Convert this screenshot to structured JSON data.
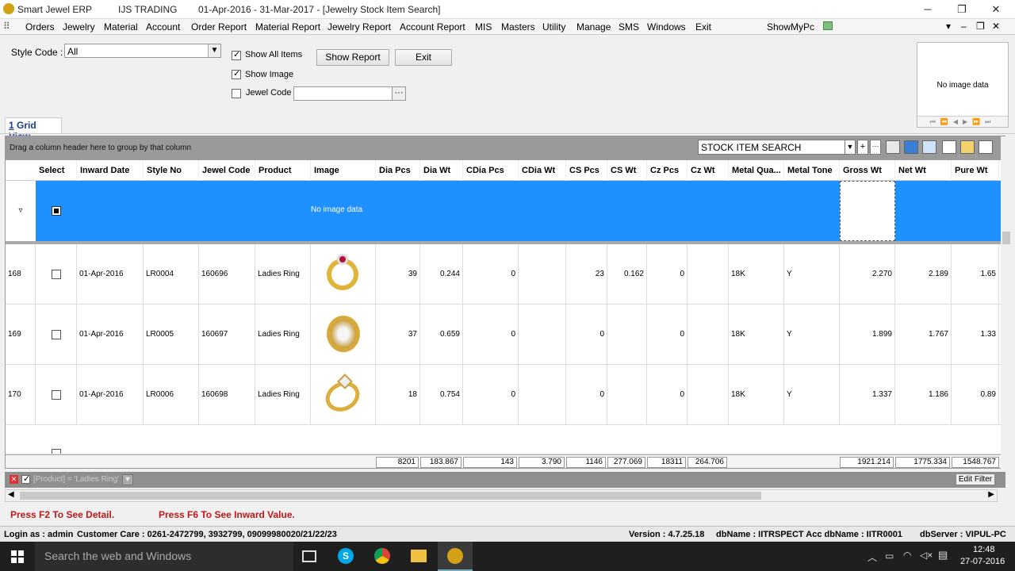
{
  "window": {
    "app_name": "Smart Jewel ERP",
    "company": "IJS TRADING",
    "title": "01-Apr-2016 - 31-Mar-2017 - [Jewelry Stock Item Search]"
  },
  "menu": [
    "Orders",
    "Jewelry",
    "Material",
    "Account",
    "Order Report",
    "Material Report",
    "Jewelry Report",
    "Account Report",
    "MIS",
    "Masters",
    "Utility",
    "Manage",
    "SMS",
    "Windows",
    "Exit",
    "ShowMyPc"
  ],
  "filters": {
    "style_code_label": "Style Code :",
    "style_code_value": "All",
    "show_all_items": "Show All Items",
    "show_image": "Show Image",
    "jewel_code": "Jewel Code",
    "show_report": "Show Report",
    "exit": "Exit"
  },
  "image_panel": {
    "text": "No image data"
  },
  "tab": {
    "number": "1",
    "label": "Grid View"
  },
  "grid": {
    "group_hint": "Drag a column header here to group by that column",
    "search_text": "STOCK ITEM SEARCH",
    "columns": [
      "Select",
      "Inward Date",
      "Style No",
      "Jewel Code",
      "Product",
      "Image",
      "Dia Pcs",
      "Dia Wt",
      "CDia Pcs",
      "CDia Wt",
      "CS Pcs",
      "CS Wt",
      "Cz Pcs",
      "Cz Wt",
      "Metal Qua...",
      "Metal Tone",
      "Gross Wt",
      "Net Wt",
      "Pure Wt"
    ],
    "filter_row_image_text": "No image data",
    "rows": [
      {
        "no": "168",
        "date": "01-Apr-2016",
        "style": "LR0004",
        "jewel": "160696",
        "product": "Ladies Ring",
        "dia_pcs": "39",
        "dia_wt": "0.244",
        "cdia_pcs": "0",
        "cs_pcs": "23",
        "cs_wt": "0.162",
        "cz_pcs": "0",
        "metal_q": "18K",
        "tone": "Y",
        "gross": "2.270",
        "net": "2.189",
        "pure": "1.65"
      },
      {
        "no": "169",
        "date": "01-Apr-2016",
        "style": "LR0005",
        "jewel": "160697",
        "product": "Ladies Ring",
        "dia_pcs": "37",
        "dia_wt": "0.659",
        "cdia_pcs": "0",
        "cs_pcs": "0",
        "cs_wt": "",
        "cz_pcs": "0",
        "metal_q": "18K",
        "tone": "Y",
        "gross": "1.899",
        "net": "1.767",
        "pure": "1.33"
      },
      {
        "no": "170",
        "date": "01-Apr-2016",
        "style": "LR0006",
        "jewel": "160698",
        "product": "Ladies Ring",
        "dia_pcs": "18",
        "dia_wt": "0.754",
        "cdia_pcs": "0",
        "cs_pcs": "0",
        "cs_wt": "",
        "cz_pcs": "0",
        "metal_q": "18K",
        "tone": "Y",
        "gross": "1.337",
        "net": "1.186",
        "pure": "0.89"
      }
    ],
    "totals": {
      "dia_pcs": "8201",
      "dia_wt": "183.867",
      "cdia_pcs": "143",
      "cdia_wt": "3.790",
      "cs_pcs": "1146",
      "cs_wt": "277.069",
      "cz_pcs": "18311",
      "cz_wt": "264.706",
      "gross": "1921.214",
      "net": "1775.334",
      "pure": "1548.767"
    },
    "active_filter": "[Product] = 'Ladies Ring'",
    "edit_filter": "Edit Filter"
  },
  "hints": {
    "f2": "Press F2 To See Detail.",
    "f6": "Press F6 To See Inward Value."
  },
  "status": {
    "login": "Login as : admin",
    "care": "Customer Care : 0261-2472799, 3932799, 09099980020/21/22/23",
    "version": "Version : 4.7.25.18",
    "db": "dbName : IITRSPECT Acc dbName : IITR0001",
    "server": "dbServer : VIPUL-PC"
  },
  "taskbar": {
    "search": "Search the web and Windows",
    "time": "12:48",
    "date": "27-07-2016"
  }
}
